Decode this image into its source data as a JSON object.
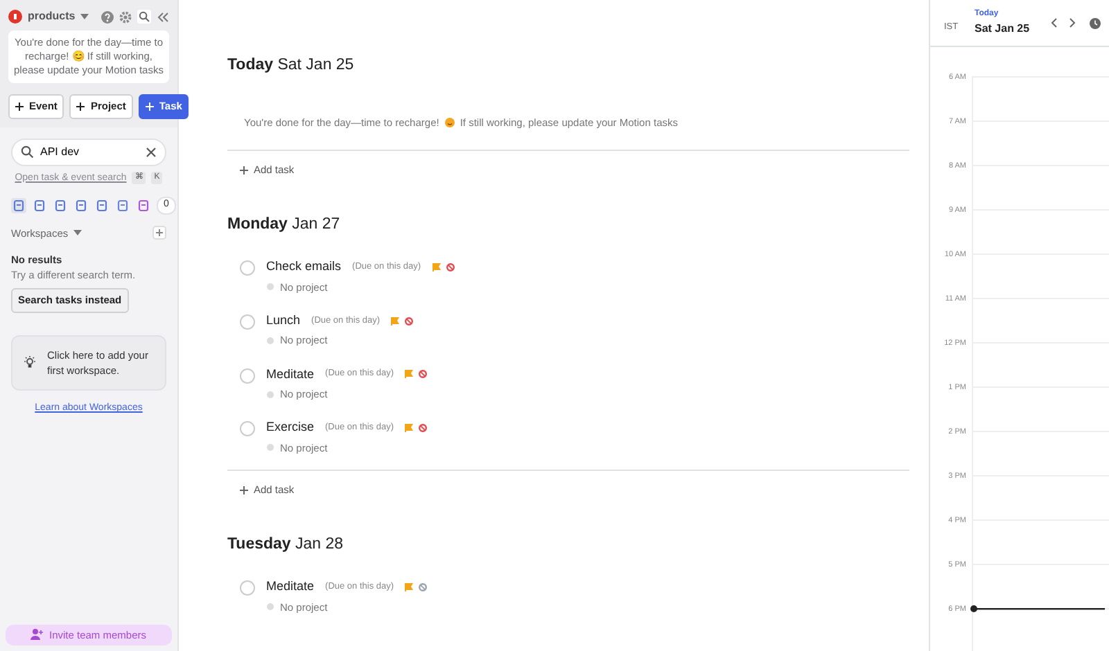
{
  "sidebar": {
    "workspace": "products",
    "notice": "You're done for the day—time to recharge! 😊 If still working, please update your Motion tasks",
    "buttons": [
      {
        "label": "Event",
        "kind": "outline"
      },
      {
        "label": "Project",
        "kind": "outline"
      },
      {
        "label": "Task",
        "kind": "primary"
      }
    ],
    "search": {
      "value": "API dev",
      "link": "Open task & event search",
      "keys": [
        "⌘",
        "K"
      ]
    },
    "filter_count": "0",
    "workspaces": {
      "title": "Workspaces",
      "empty_title": "No results",
      "empty_hint": "Try a different search term.",
      "search_button": "Search tasks instead",
      "add_card": "Click here to add your first workspace.",
      "learn_link": "Learn about Workspaces"
    },
    "invite": "Invite team members"
  },
  "days": [
    {
      "day": "Today",
      "date": "Sat Jan 25",
      "banner": {
        "before": "You're done for the day—time to recharge!",
        "after": "If still working, please update your Motion tasks"
      },
      "add_task": "Add task"
    },
    {
      "day": "Monday",
      "date": "Jan 27",
      "add_task": "Add task",
      "tasks": [
        {
          "name": "Check emails",
          "due": "(Due on this day)",
          "project": "No project",
          "color": "#e5484d",
          "done": false
        },
        {
          "name": "Lunch",
          "due": "(Due on this day)",
          "project": "No project",
          "color": "#e5484d",
          "done": false
        },
        {
          "name": "Meditate",
          "due": "(Due on this day)",
          "project": "No project",
          "color": "#e5484d",
          "done": false
        },
        {
          "name": "Exercise",
          "due": "(Due on this day)",
          "project": "No project",
          "color": "#e5484d",
          "done": false
        }
      ]
    },
    {
      "day": "Tuesday",
      "date": "Jan 28",
      "tasks": [
        {
          "name": "Meditate",
          "due": "(Due on this day)",
          "project": "No project",
          "color": "#9ca3af",
          "done": false
        }
      ]
    }
  ],
  "calendar": {
    "timezone": "IST",
    "today": "Today",
    "date": "Sat Jan 25",
    "hours": [
      "6 AM",
      "7 AM",
      "8 AM",
      "9 AM",
      "10 AM",
      "11 AM",
      "12 PM",
      "1 PM",
      "2 PM",
      "3 PM",
      "4 PM",
      "5 PM",
      "6 PM"
    ]
  }
}
